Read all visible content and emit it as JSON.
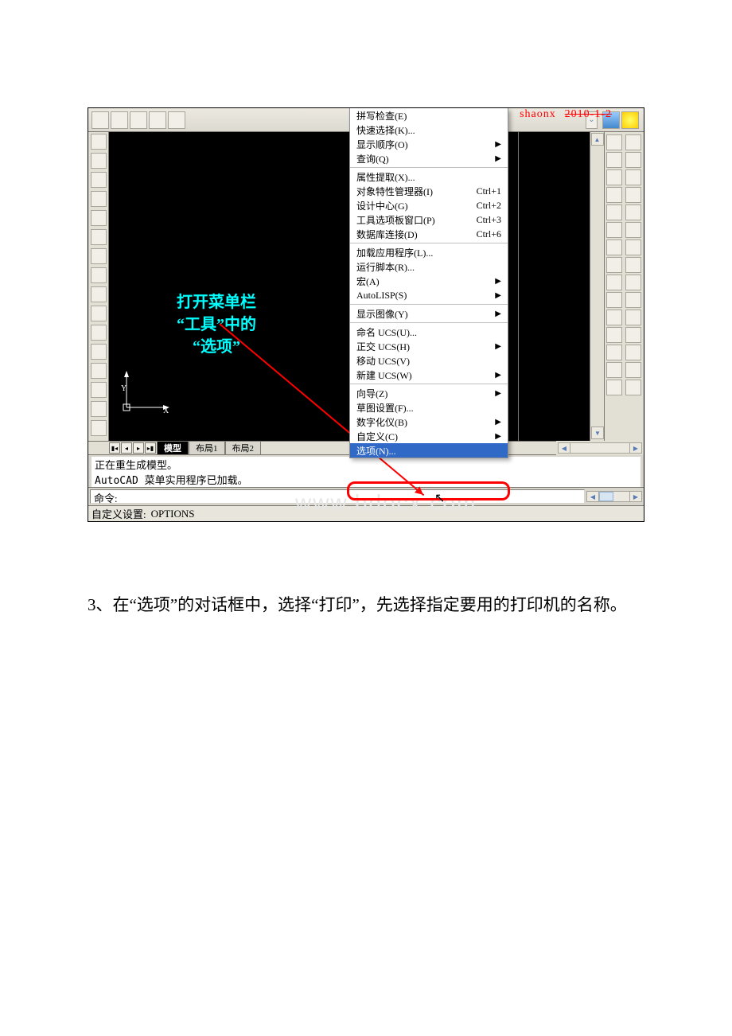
{
  "watermark_top": {
    "name": "shaonx",
    "date": "2010-1-2"
  },
  "watermark_big": "www.bdocx.com",
  "callout": {
    "l1": "打开菜单栏",
    "l2": "“工具”中的",
    "l3": "“选项”"
  },
  "menu": {
    "group1": [
      {
        "label": "拼写检查(E)"
      },
      {
        "label": "快速选择(K)..."
      },
      {
        "label": "显示顺序(O)",
        "sub": true
      },
      {
        "label": "查询(Q)",
        "sub": true
      }
    ],
    "group2": [
      {
        "label": "属性提取(X)..."
      },
      {
        "label": "对象特性管理器(I)",
        "sc": "Ctrl+1"
      },
      {
        "label": "设计中心(G)",
        "sc": "Ctrl+2"
      },
      {
        "label": "工具选项板窗口(P)",
        "sc": "Ctrl+3"
      },
      {
        "label": "数据库连接(D)",
        "sc": "Ctrl+6"
      }
    ],
    "group3": [
      {
        "label": "加载应用程序(L)..."
      },
      {
        "label": "运行脚本(R)..."
      },
      {
        "label": "宏(A)",
        "sub": true
      },
      {
        "label": "AutoLISP(S)",
        "sub": true
      }
    ],
    "group4": [
      {
        "label": "显示图像(Y)",
        "sub": true
      }
    ],
    "group5": [
      {
        "label": "命名 UCS(U)..."
      },
      {
        "label": "正交 UCS(H)",
        "sub": true
      },
      {
        "label": "移动 UCS(V)"
      },
      {
        "label": "新建 UCS(W)",
        "sub": true
      }
    ],
    "group6": [
      {
        "label": "向导(Z)",
        "sub": true
      },
      {
        "label": "草图设置(F)..."
      },
      {
        "label": "数字化仪(B)",
        "sub": true
      },
      {
        "label": "自定义(C)",
        "sub": true
      },
      {
        "label": "选项(N)...",
        "hl": true
      }
    ]
  },
  "tabs": {
    "model": "模型",
    "layout1": "布局1",
    "layout2": "布局2"
  },
  "cmdlog": {
    "l1": "正在重生成模型。",
    "l2": "AutoCAD 菜单实用程序已加载。"
  },
  "cmd_prompt": "命令:",
  "status": {
    "label": "自定义设置:",
    "value": "OPTIONS"
  },
  "axis": {
    "x": "X",
    "y": "Y"
  },
  "toolbar_icons": [
    "win1",
    "win2",
    "win3",
    "win4",
    "win5"
  ],
  "doc_text": "3、在“选项”的对话框中，选择“打印”，先选择指定要用的打印机的名称。"
}
